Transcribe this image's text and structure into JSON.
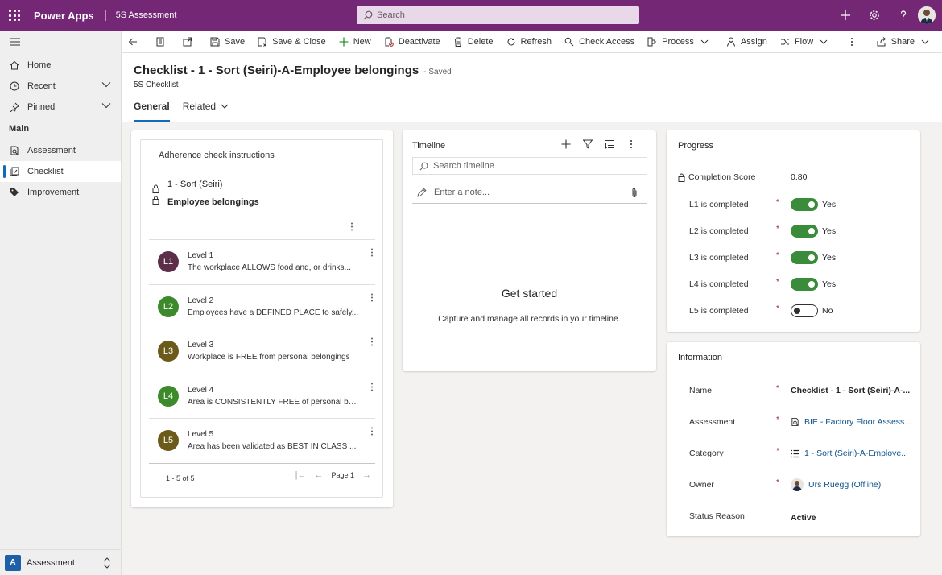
{
  "topbar": {
    "app_name": "Power Apps",
    "environment": "5S Assessment",
    "search_placeholder": "Search",
    "brand_color": "#742774"
  },
  "sidebar": {
    "items": [
      {
        "label": "Home",
        "icon": "home-icon"
      },
      {
        "label": "Recent",
        "icon": "clock-icon"
      },
      {
        "label": "Pinned",
        "icon": "pin-icon"
      }
    ],
    "section": "Main",
    "entities": [
      {
        "label": "Assessment",
        "icon": "assessment-icon"
      },
      {
        "label": "Checklist",
        "icon": "checklist-icon",
        "active": true
      },
      {
        "label": "Improvement",
        "icon": "tag-icon"
      }
    ],
    "area_badge": "A",
    "area_name": "Assessment"
  },
  "commands": {
    "save": "Save",
    "save_close": "Save & Close",
    "new": "New",
    "deactivate": "Deactivate",
    "delete": "Delete",
    "refresh": "Refresh",
    "check_access": "Check Access",
    "process": "Process",
    "assign": "Assign",
    "flow": "Flow",
    "share": "Share"
  },
  "header": {
    "title": "Checklist - 1 - Sort (Seiri)-A-Employee belongings",
    "status": "- Saved",
    "entity": "5S Checklist",
    "tabs": [
      "General",
      "Related"
    ]
  },
  "adherence": {
    "title": "Adherence check instructions",
    "category": "1 - Sort (Seiri)",
    "name": "Employee belongings",
    "levels": [
      {
        "initials": "L1",
        "name": "Level 1",
        "desc": "The workplace ALLOWS food and, or drinks...",
        "color": "#5c2e4a"
      },
      {
        "initials": "L2",
        "name": "Level 2",
        "desc": "Employees have a DEFINED PLACE to safely...",
        "color": "#3d8a2b"
      },
      {
        "initials": "L3",
        "name": "Level 3",
        "desc": "Workplace is FREE from personal belongings",
        "color": "#6b5a1a"
      },
      {
        "initials": "L4",
        "name": "Level 4",
        "desc": "Area is CONSISTENTLY FREE of personal bel...",
        "color": "#3d8a2b"
      },
      {
        "initials": "L5",
        "name": "Level 5",
        "desc": "Area has been validated as BEST IN CLASS ...",
        "color": "#6b5a1a"
      }
    ],
    "count": "1 - 5 of 5",
    "page": "Page 1"
  },
  "timeline": {
    "title": "Timeline",
    "search_placeholder": "Search timeline",
    "note_placeholder": "Enter a note...",
    "empty_title": "Get started",
    "empty_sub": "Capture and manage all records in your timeline."
  },
  "progress": {
    "title": "Progress",
    "score_label": "Completion Score",
    "score_value": "0.80",
    "fields": [
      {
        "label": "L1 is completed",
        "value": "Yes",
        "on": true
      },
      {
        "label": "L2 is completed",
        "value": "Yes",
        "on": true
      },
      {
        "label": "L3 is completed",
        "value": "Yes",
        "on": true
      },
      {
        "label": "L4 is completed",
        "value": "Yes",
        "on": true
      },
      {
        "label": "L5 is completed",
        "value": "No",
        "on": false
      }
    ],
    "required_mark": "*"
  },
  "information": {
    "title": "Information",
    "name_label": "Name",
    "name_value": "Checklist - 1 - Sort (Seiri)-A-...",
    "assessment_label": "Assessment",
    "assessment_value": "BIE - Factory Floor Assess...",
    "category_label": "Category",
    "category_value": "1 - Sort (Seiri)-A-Employe...",
    "owner_label": "Owner",
    "owner_value": "Urs Rüegg (Offline)",
    "status_label": "Status Reason",
    "status_value": "Active"
  }
}
